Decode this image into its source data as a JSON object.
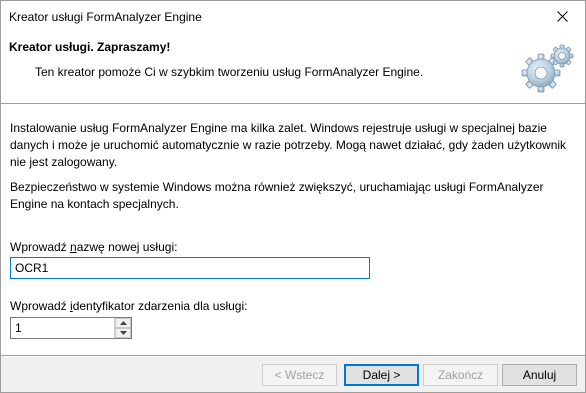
{
  "window": {
    "title": "Kreator usługi FormAnalyzer Engine",
    "close_icon": "close-icon"
  },
  "header": {
    "title": "Kreator usługi. Zapraszamy!",
    "subtitle": "Ten kreator pomoże Ci w szybkim tworzeniu usług FormAnalyzer Engine.",
    "icon": "gears-icon"
  },
  "content": {
    "paragraph1": "Instalowanie usług FormAnalyzer Engine ma kilka zalet. Windows rejestruje usługi w specjalnej bazie danych i może je uruchomić automatycznie w razie potrzeby. Mogą nawet działać, gdy żaden użytkownik nie jest zalogowany.",
    "paragraph2": "Bezpieczeństwo w systemie Windows można również zwiększyć, uruchamiając usługi FormAnalyzer Engine na kontach specjalnych.",
    "name_label_pre": "Wprowadź ",
    "name_label_accel": "n",
    "name_label_post": "azwę nowej usługi:",
    "name_value": "OCR1",
    "id_label_pre": "Wprowadź ",
    "id_label_accel": "i",
    "id_label_post": "dentyfikator zdarzenia dla usługi:",
    "id_value": "1"
  },
  "buttons": {
    "back": "< Wstecz",
    "next": "Dalej >",
    "finish": "Zakończ",
    "cancel": "Anuluj"
  },
  "colors": {
    "focus_accent": "#0078d7",
    "disabled_text": "#a0a0a0"
  }
}
